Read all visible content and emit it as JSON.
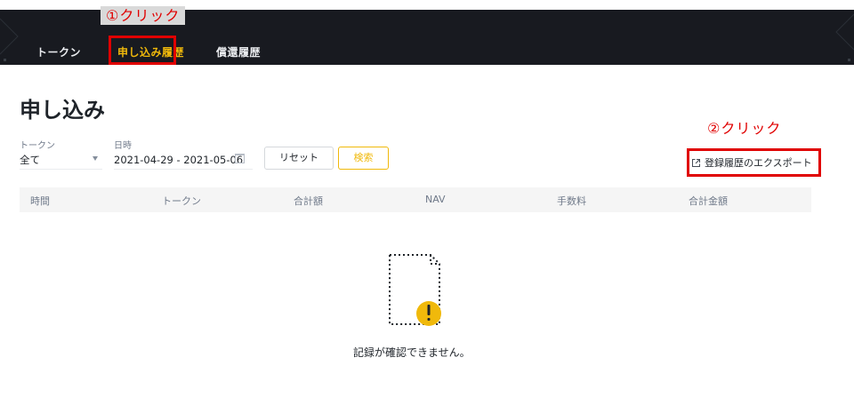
{
  "nav": {
    "tabs": [
      {
        "label": "トークン"
      },
      {
        "label": "申し込み履歴",
        "active": true
      },
      {
        "label": "償還履歴"
      }
    ]
  },
  "annotations": {
    "step1": "①クリック",
    "step2": "②クリック"
  },
  "page": {
    "title": "申し込み"
  },
  "filters": {
    "token_label": "トークン",
    "token_value": "全て",
    "date_label": "日時",
    "date_value": "2021-04-29 - 2021-05-06",
    "reset_label": "リセット",
    "search_label": "検索"
  },
  "export": {
    "label": "登録履歴のエクスポート"
  },
  "table": {
    "columns": [
      "時間",
      "トークン",
      "合計額",
      "NAV",
      "手数料",
      "合計金額"
    ]
  },
  "empty": {
    "message": "記録が確認できません。"
  },
  "colors": {
    "accent": "#f0b90b",
    "header_bg": "#181a20",
    "annotation": "#e00000"
  },
  "icons": {
    "date": "calendar-icon",
    "export": "external-link-icon",
    "empty": "empty-document-warning-icon",
    "select": "caret-down-icon"
  }
}
